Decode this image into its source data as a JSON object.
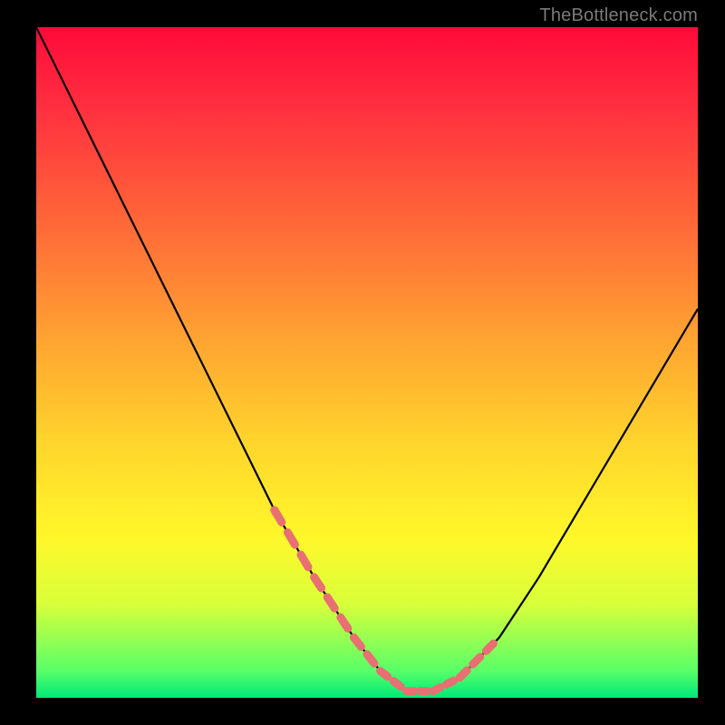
{
  "attribution": "TheBottleneck.com",
  "chart_data": {
    "type": "line",
    "title": "",
    "xlabel": "",
    "ylabel": "",
    "xlim": [
      0,
      100
    ],
    "ylim": [
      0,
      100
    ],
    "series": [
      {
        "name": "curve",
        "x": [
          0,
          6,
          12,
          18,
          24,
          30,
          36,
          42,
          48,
          52,
          56,
          60,
          64,
          70,
          76,
          82,
          88,
          94,
          100
        ],
        "values": [
          100,
          88,
          76,
          64,
          52,
          40,
          28,
          18,
          9,
          4,
          1,
          1,
          3,
          9,
          18,
          28,
          38,
          48,
          58
        ]
      }
    ],
    "highlights": [
      {
        "name": "left-dashes",
        "x_range": [
          36,
          50
        ]
      },
      {
        "name": "bottom-dashes",
        "x_range": [
          50,
          60
        ]
      },
      {
        "name": "right-dashes",
        "x_range": [
          60,
          70
        ]
      }
    ]
  },
  "colors": {
    "curve_stroke": "#000000",
    "highlight_stroke": "#e86f72"
  }
}
